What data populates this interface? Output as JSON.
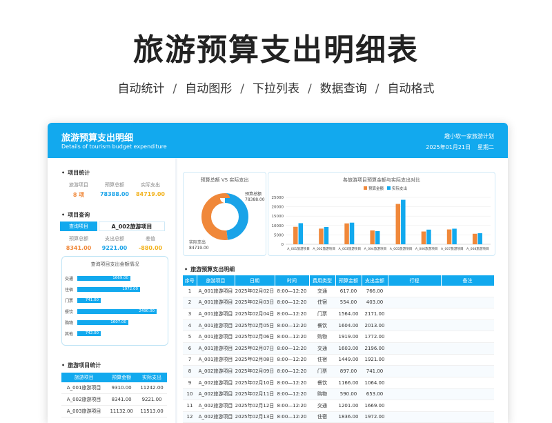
{
  "page": {
    "title": "旅游预算支出明细表",
    "features": [
      "自动统计",
      "自动图形",
      "下拉列表",
      "数据查询",
      "自动格式"
    ]
  },
  "header": {
    "title": "旅游预算支出明细",
    "subtitle": "Details of tourism budget expenditure",
    "org": "趣小软一家旅游计划",
    "date": "2025年01月21日",
    "weekday": "星期二"
  },
  "stats": {
    "section_title": "项目统计",
    "labels": [
      "旅游项目",
      "预算总额",
      "实际支出"
    ],
    "values": [
      "8 项",
      "78388.00",
      "84719.00"
    ]
  },
  "query": {
    "section_title": "项目查询",
    "label": "查询项目",
    "selected": "A_002旅游项目",
    "labels": [
      "预算总额",
      "支出总额",
      "差值"
    ],
    "values": [
      "8341.00",
      "9221.00",
      "-880.00"
    ]
  },
  "query_chart": {
    "title": "查询项目支出金额情况",
    "color": "#12a9ee",
    "items": [
      {
        "label": "交通",
        "value": 1669.0,
        "display": "1669.00"
      },
      {
        "label": "住宿",
        "value": 1972.0,
        "display": "1972.00"
      },
      {
        "label": "门票",
        "value": 741.0,
        "display": "741.00"
      },
      {
        "label": "餐饮",
        "value": 2490.0,
        "display": "2490.00"
      },
      {
        "label": "购物",
        "value": 1607.0,
        "display": "1607.00"
      },
      {
        "label": "其他",
        "value": 742.0,
        "display": "742.00"
      }
    ]
  },
  "project_stats": {
    "section_title": "旅游项目统计",
    "columns": [
      "旅游项目",
      "预算金额",
      "实际支出"
    ],
    "rows": [
      [
        "A_001旅游项目",
        "9310.00",
        "11242.00"
      ],
      [
        "A_002旅游项目",
        "8341.00",
        "9221.00"
      ],
      [
        "A_003旅游项目",
        "11132.00",
        "11513.00"
      ]
    ]
  },
  "donut": {
    "title": "预算总额 VS 实际支出",
    "budget_label": "预算总额",
    "budget_value": "78388.00",
    "actual_label": "实际支出",
    "actual_value": "84719.00"
  },
  "chart_data": [
    {
      "type": "pie",
      "title": "预算总额 VS 实际支出",
      "labels": [
        "预算总额",
        "实际支出"
      ],
      "values": [
        78388.0,
        84719.0
      ],
      "colors": [
        "#1aa3e8",
        "#f0883a"
      ]
    },
    {
      "type": "bar",
      "title": "各旅游项目预算金额与实际支出对比",
      "categories": [
        "A_001旅游项目",
        "A_002旅游项目",
        "A_003旅游项目",
        "A_004旅游项目",
        "A_005旅游项目",
        "A_006旅游项目",
        "A_007旅游项目",
        "A_008旅游项目"
      ],
      "series": [
        {
          "name": "预算金额",
          "color": "#f0883a",
          "values": [
            9310,
            8341,
            11132,
            7400,
            21500,
            6800,
            7900,
            5600
          ]
        },
        {
          "name": "实际支出",
          "color": "#12a9ee",
          "values": [
            11242,
            9221,
            11513,
            7000,
            23700,
            7800,
            8300,
            5900
          ]
        }
      ],
      "ylim": [
        0,
        25000
      ],
      "yticks": [
        "0",
        "5000",
        "10000",
        "15000",
        "20000",
        "25000"
      ],
      "legend": "top-center"
    }
  ],
  "detail": {
    "section_title": "旅游预算支出明细",
    "columns": [
      "序号",
      "旅游项目",
      "日期",
      "时间",
      "费用类型",
      "预算金额",
      "支出金额",
      "行程",
      "备注"
    ],
    "rows": [
      [
        "1",
        "A_001旅游项目",
        "2025年02月02日",
        "8:00—12:20",
        "交通",
        "617.00",
        "766.00",
        "",
        ""
      ],
      [
        "2",
        "A_001旅游项目",
        "2025年02月03日",
        "8:00—12:20",
        "住宿",
        "554.00",
        "403.00",
        "",
        ""
      ],
      [
        "3",
        "A_001旅游项目",
        "2025年02月04日",
        "8:00—12:20",
        "门票",
        "1564.00",
        "2171.00",
        "",
        ""
      ],
      [
        "4",
        "A_001旅游项目",
        "2025年02月05日",
        "8:00—12:20",
        "餐饮",
        "1604.00",
        "2013.00",
        "",
        ""
      ],
      [
        "5",
        "A_001旅游项目",
        "2025年02月06日",
        "8:00—12:20",
        "购物",
        "1919.00",
        "1772.00",
        "",
        ""
      ],
      [
        "6",
        "A_001旅游项目",
        "2025年02月07日",
        "8:00—12:20",
        "交通",
        "1603.00",
        "2196.00",
        "",
        ""
      ],
      [
        "7",
        "A_001旅游项目",
        "2025年02月08日",
        "8:00—12:20",
        "住宿",
        "1449.00",
        "1921.00",
        "",
        ""
      ],
      [
        "8",
        "A_002旅游项目",
        "2025年02月09日",
        "8:00—12:20",
        "门票",
        "897.00",
        "741.00",
        "",
        ""
      ],
      [
        "9",
        "A_002旅游项目",
        "2025年02月10日",
        "8:00—12:20",
        "餐饮",
        "1166.00",
        "1064.00",
        "",
        ""
      ],
      [
        "10",
        "A_002旅游项目",
        "2025年02月11日",
        "8:00—12:20",
        "购物",
        "590.00",
        "653.00",
        "",
        ""
      ],
      [
        "11",
        "A_002旅游项目",
        "2025年02月12日",
        "8:00—12:20",
        "交通",
        "1201.00",
        "1669.00",
        "",
        ""
      ],
      [
        "12",
        "A_002旅游项目",
        "2025年02月13日",
        "8:00—12:20",
        "住宿",
        "1836.00",
        "1972.00",
        "",
        ""
      ]
    ]
  }
}
